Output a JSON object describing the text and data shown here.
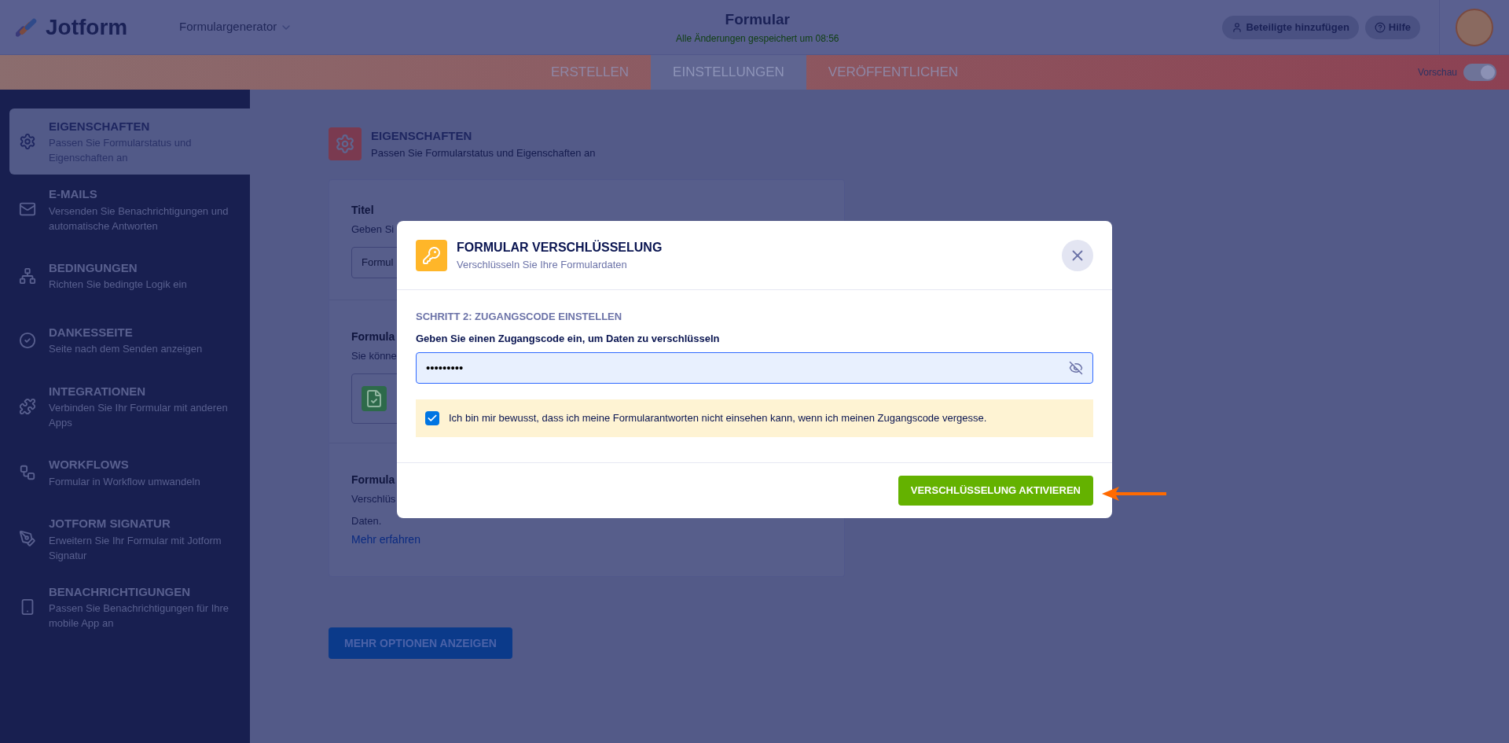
{
  "header": {
    "logo": "Jotform",
    "builder": "Formulargenerator",
    "title": "Formular",
    "save_status": "Alle Änderungen gespeichert um 08:56",
    "buttons": [
      {
        "kind": "user",
        "label": "Beteiligte hinzufügen"
      },
      {
        "kind": "help",
        "label": "Hilfe"
      }
    ]
  },
  "tabs": [
    {
      "label": "ERSTELLEN",
      "selected": false
    },
    {
      "label": "EINSTELLUNGEN",
      "selected": true
    },
    {
      "label": "VERÖFFENTLICHEN",
      "selected": false
    }
  ],
  "preview": {
    "label": "Vorschau",
    "on": true
  },
  "sidebar": {
    "items": [
      {
        "kind": "settings",
        "title": "EIGENSCHAFTEN",
        "description": "Passen Sie Formularstatus und Eigenschaften an",
        "selected": true
      },
      {
        "kind": "mail",
        "title": "E-MAILS",
        "description": "Versenden Sie Benachrichtigungen und automatische Antworten",
        "selected": false
      },
      {
        "kind": "logic",
        "title": "BEDINGUNGEN",
        "description": "Richten Sie bedingte Logik ein",
        "selected": false
      },
      {
        "kind": "check",
        "title": "DANKESSEITE",
        "description": "Seite nach dem Senden anzeigen",
        "selected": false
      },
      {
        "kind": "puzzle",
        "title": "INTEGRATIONEN",
        "description": "Verbinden Sie Ihr Formular mit anderen Apps",
        "selected": false
      },
      {
        "kind": "workflow",
        "title": "WORKFLOWS",
        "description": "Formular in Workflow umwandeln",
        "selected": false
      },
      {
        "kind": "sign",
        "title": "JOTFORM SIGNATUR",
        "description": "Erweitern Sie Ihr Formular mit Jotform Signatur",
        "selected": false
      },
      {
        "kind": "mobile",
        "title": "BENACHRICHTIGUNGEN",
        "description": "Passen Sie Benachrichtigungen für Ihre mobile App an",
        "selected": false
      }
    ]
  },
  "main": {
    "title": "EIGENSCHAFTEN",
    "subtitle": "Passen Sie Formularstatus und Eigenschaften an",
    "sections": [
      {
        "kind": "input",
        "heading": "Titel",
        "description": "Geben Si",
        "value": "Formul"
      },
      {
        "kind": "card",
        "heading": "Formula",
        "description": "Sie könne"
      },
      {
        "kind": "link",
        "heading": "Formula",
        "description": "Verschlüs",
        "description_2": "Daten.",
        "link": "Mehr erfahren"
      }
    ],
    "more_button": "MEHR OPTIONEN ANZEIGEN"
  },
  "modal": {
    "title": "FORMULAR VERSCHLÜSSELUNG",
    "subtitle": "Verschlüsseln Sie Ihre Formulardaten",
    "step": "SCHRITT 2: ZUGANGSCODE EINSTELLEN",
    "field_label": "Geben Sie einen Zugangscode ein, um Daten zu verschlüsseln",
    "field_value": "•••••••••",
    "consent": {
      "checked": true,
      "label": "Ich bin mir bewusst, dass ich meine Formularantworten nicht einsehen kann, wenn ich meinen Zugangscode vergesse."
    },
    "button": "VERSCHLÜSSELUNG AKTIVIEREN"
  }
}
